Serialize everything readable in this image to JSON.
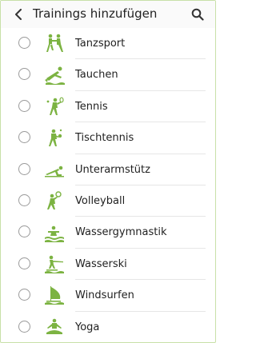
{
  "header": {
    "title": "Trainings hinzufügen",
    "back_icon": "back-arrow-icon",
    "search_icon": "search-icon"
  },
  "colors": {
    "accent": "#7cb342",
    "radio_border": "#9a9a9a",
    "divider": "#e6e6e6"
  },
  "items": [
    {
      "label": "Tanzsport",
      "icon": "dance-icon",
      "selected": false
    },
    {
      "label": "Tauchen",
      "icon": "diving-icon",
      "selected": false
    },
    {
      "label": "Tennis",
      "icon": "tennis-icon",
      "selected": false
    },
    {
      "label": "Tischtennis",
      "icon": "table-tennis-icon",
      "selected": false
    },
    {
      "label": "Unterarmstütz",
      "icon": "plank-icon",
      "selected": false
    },
    {
      "label": "Volleyball",
      "icon": "volleyball-icon",
      "selected": false
    },
    {
      "label": "Wassergymnastik",
      "icon": "water-aerobics-icon",
      "selected": false
    },
    {
      "label": "Wasserski",
      "icon": "water-ski-icon",
      "selected": false
    },
    {
      "label": "Windsurfen",
      "icon": "windsurf-icon",
      "selected": false
    },
    {
      "label": "Yoga",
      "icon": "yoga-icon",
      "selected": false
    }
  ]
}
